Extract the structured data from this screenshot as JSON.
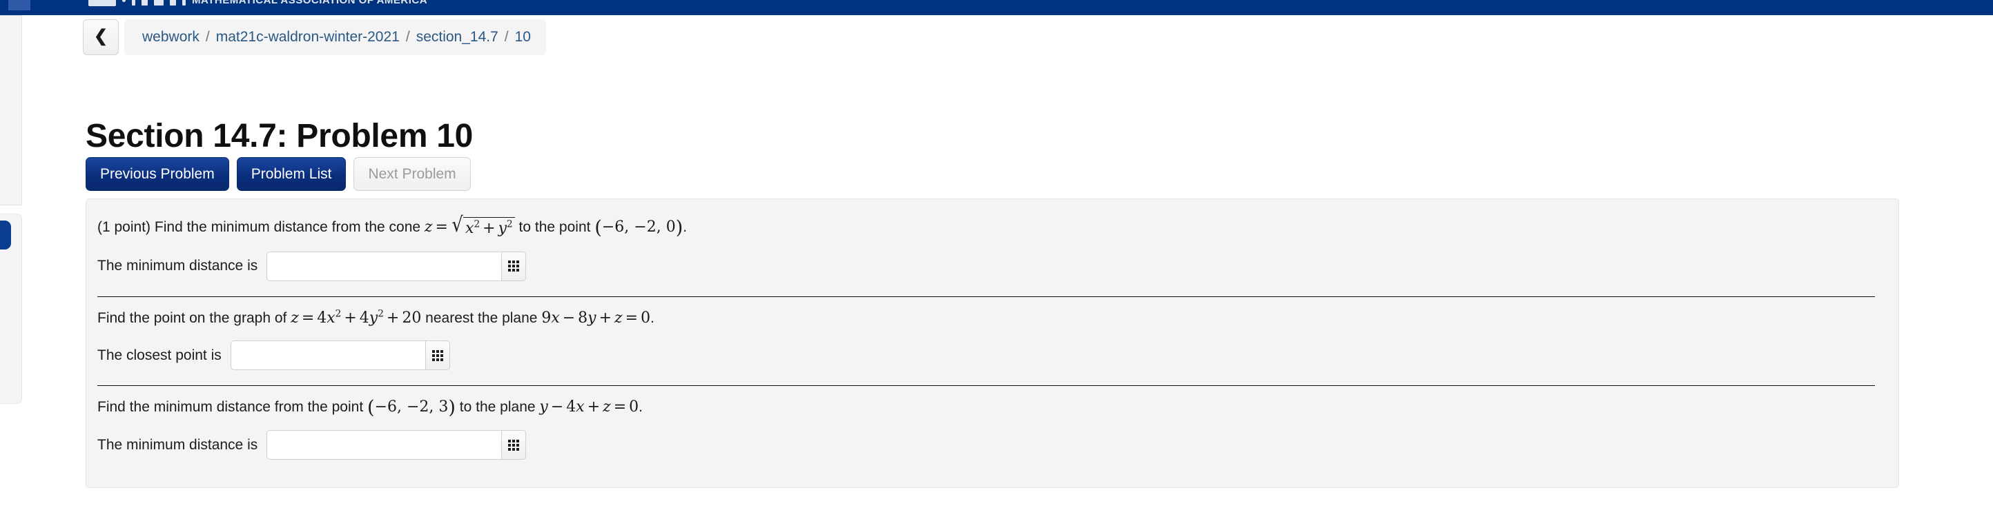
{
  "banner": {
    "org_title": "MATHEMATICAL ASSOCIATION OF AMERICA"
  },
  "breadcrumb": {
    "back_icon": "chevron-left-icon",
    "items": [
      {
        "label": "webwork"
      },
      {
        "label": "mat21c-waldron-winter-2021"
      },
      {
        "label": "section_14.7"
      },
      {
        "label": "10"
      }
    ],
    "separator": "/"
  },
  "page": {
    "title": "Section 14.7: Problem 10"
  },
  "nav_buttons": [
    {
      "label": "Previous Problem",
      "state": "enabled"
    },
    {
      "label": "Problem List",
      "state": "enabled"
    },
    {
      "label": "Next Problem",
      "state": "disabled"
    }
  ],
  "problems": [
    {
      "points_note": "(1 point)",
      "text_before": "Find the minimum distance from the cone",
      "math": "z = sqrt(x^2 + y^2)",
      "text_mid": "to the point",
      "math_point": "(-6, -2, 0)",
      "trailing": ".",
      "answer_label": "The minimum distance is",
      "answer_value": "",
      "answer_placeholder": "",
      "keypad_icon": "keypad-grid-icon"
    },
    {
      "text_before": "Find the point on the graph of",
      "math": "z = 4x^2 + 4y^2 + 20",
      "text_mid": "nearest the plane",
      "math_plane": "9x - 8y + z = 0",
      "trailing": ".",
      "answer_label": "The closest point is",
      "answer_value": "",
      "answer_placeholder": "",
      "keypad_icon": "keypad-grid-icon"
    },
    {
      "text_before": "Find the minimum distance from the point",
      "math_point": "(-6, -2, 3)",
      "text_mid": "to the plane",
      "math_plane": "y - 4x + z = 0",
      "trailing": ".",
      "answer_label": "The minimum distance is",
      "answer_value": "",
      "answer_placeholder": "",
      "keypad_icon": "keypad-grid-icon"
    }
  ],
  "colors": {
    "banner_blue": "#00337f",
    "button_blue": "#0b2f7d",
    "card_bg": "#f4f4f4",
    "link_blue": "#2a5885",
    "rail_tab_blue": "#0b3d91"
  }
}
